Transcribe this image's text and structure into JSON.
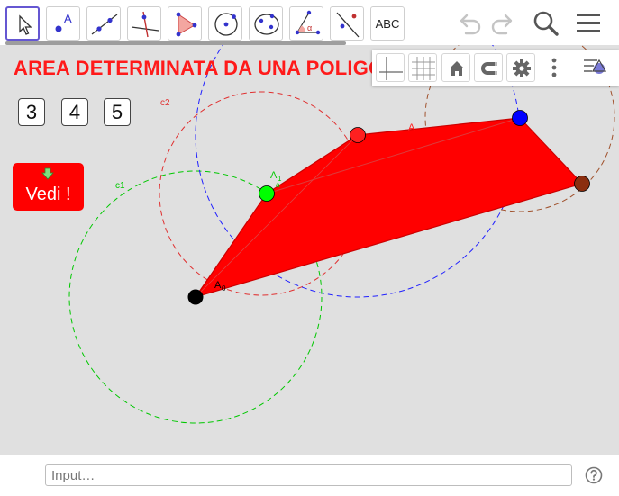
{
  "toolbar": {
    "tools": [
      {
        "name": "move-tool-icon",
        "active": true
      },
      {
        "name": "point-tool-icon",
        "label": "A"
      },
      {
        "name": "line-tool-icon"
      },
      {
        "name": "perpendicular-line-tool-icon"
      },
      {
        "name": "polygon-tool-icon"
      },
      {
        "name": "circle-tool-icon"
      },
      {
        "name": "conic-tool-icon"
      },
      {
        "name": "angle-tool-icon",
        "label": "α"
      },
      {
        "name": "reflect-tool-icon"
      },
      {
        "name": "text-tool-icon",
        "label": "ABC"
      }
    ],
    "icons": [
      "undo-icon",
      "redo-icon",
      "search-icon",
      "menu-icon"
    ]
  },
  "graphics": {
    "title": "AREA  DETERMINATA DA UNA POLIGONALE",
    "number_buttons": [
      "3",
      "4",
      "5"
    ],
    "vedi_label": "Vedi !",
    "labels": {
      "c1": "c1",
      "c2": "c2",
      "a1": "A",
      "a1_sub": "1",
      "a0": "A",
      "a0_sub": "0",
      "seg_a": "A",
      "tiny_a": "a"
    },
    "colors": {
      "polygon_fill": "#ff0000",
      "title": "#ff1a1a",
      "circle_c1": "#00c800",
      "circle_c2": "#e03030",
      "circle_blue": "#2020ff",
      "circle_brown": "#a0522d",
      "point_black": "#000000",
      "point_green": "#00ff00",
      "point_red": "#ff2020",
      "point_blue": "#0000ff",
      "point_brown": "#8b2e0f",
      "background": "#e0e0e0"
    }
  },
  "stylebar": {
    "buttons": [
      "axes-icon",
      "grid-icon",
      "home-icon",
      "magnet-icon",
      "gear-icon",
      "more-vertical-icon",
      "style-bar-toggle-icon"
    ]
  },
  "input_bar": {
    "placeholder": "Input…"
  },
  "help_icon": "help-icon"
}
